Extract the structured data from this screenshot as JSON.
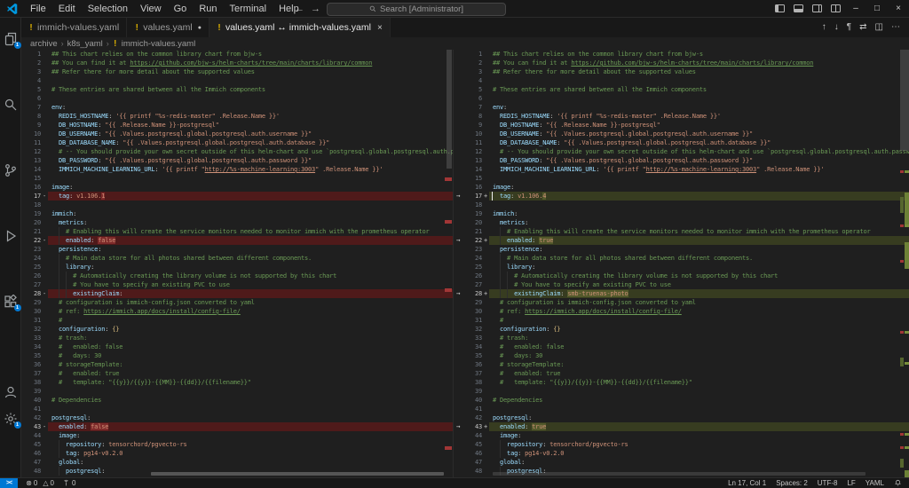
{
  "title_bar": {
    "menus": [
      "File",
      "Edit",
      "Selection",
      "View",
      "Go",
      "Run",
      "Terminal",
      "Help"
    ],
    "nav_back": "←",
    "nav_forward": "→",
    "search_label": "Search [Administrator]"
  },
  "tabs": [
    {
      "label": "immich-values.yaml",
      "icon": "!",
      "modified": false,
      "active": false
    },
    {
      "label": "values.yaml",
      "icon": "!",
      "modified": true,
      "active": false
    },
    {
      "label": "values.yaml ↔ immich-values.yaml",
      "icon": "!",
      "modified": false,
      "active": true,
      "closable": true
    }
  ],
  "editor_actions": [
    {
      "name": "previous-change",
      "glyph": "↑"
    },
    {
      "name": "next-change",
      "glyph": "↓"
    },
    {
      "name": "toggle-whitespace",
      "glyph": "¶"
    },
    {
      "name": "swap-diff-sides",
      "glyph": "⇄"
    },
    {
      "name": "split-editor",
      "glyph": "◫"
    },
    {
      "name": "more-actions",
      "glyph": "⋯"
    }
  ],
  "breadcrumb": [
    "archive",
    "k8s_yaml",
    "immich-values.yaml"
  ],
  "activity_bar": {
    "items": [
      {
        "name": "explorer",
        "badge": "1"
      },
      {
        "name": "search"
      },
      {
        "name": "source-control"
      },
      {
        "name": "run-and-debug"
      },
      {
        "name": "extensions",
        "badge": "1"
      }
    ],
    "bottom": [
      {
        "name": "accounts"
      },
      {
        "name": "settings",
        "badge": "1"
      }
    ]
  },
  "diff": {
    "lines": [
      {
        "n": 1,
        "text": "## This chart relies on the common library chart from bjw-s"
      },
      {
        "n": 2,
        "text": "## You can find it at https://github.com/bjw-s/helm-charts/tree/main/charts/library/common"
      },
      {
        "n": 3,
        "text": "## Refer there for more detail about the supported values"
      },
      {
        "n": 4,
        "text": ""
      },
      {
        "n": 5,
        "text": "# These entries are shared between all the Immich components"
      },
      {
        "n": 6,
        "text": ""
      },
      {
        "n": 7,
        "text": "env:"
      },
      {
        "n": 8,
        "text": "  REDIS_HOSTNAME: '{{ printf \"%s-redis-master\" .Release.Name }}'"
      },
      {
        "n": 9,
        "text": "  DB_HOSTNAME: \"{{ .Release.Name }}-postgresql\""
      },
      {
        "n": 10,
        "text": "  DB_USERNAME: \"{{ .Values.postgresql.global.postgresql.auth.username }}\""
      },
      {
        "n": 11,
        "text": "  DB_DATABASE_NAME: \"{{ .Values.postgresql.global.postgresql.auth.database }}\""
      },
      {
        "n": 12,
        "text": "  # -- You should provide your own secret outside of this helm-chart and use `postgresql.global.postgresql.auth.password`"
      },
      {
        "n": 13,
        "text": "  DB_PASSWORD: \"{{ .Values.postgresql.global.postgresql.auth.password }}\""
      },
      {
        "n": 14,
        "text": "  IMMICH_MACHINE_LEARNING_URL: '{{ printf \"http://%s-machine-learning:3003\" .Release.Name }}'"
      },
      {
        "n": 15,
        "text": ""
      },
      {
        "n": 16,
        "text": "image:"
      },
      {
        "n": 17,
        "change": true,
        "left": "  tag: v1.106.1",
        "right": "  tag: v1.106.4",
        "left_hl": "1",
        "right_hl": "4",
        "cursor": "right"
      },
      {
        "n": 18,
        "text": ""
      },
      {
        "n": 19,
        "text": "immich:"
      },
      {
        "n": 20,
        "text": "  metrics:"
      },
      {
        "n": 21,
        "text": "    # Enabling this will create the service monitors needed to monitor immich with the prometheus operator"
      },
      {
        "n": 22,
        "change": true,
        "left": "    enabled: false",
        "right": "    enabled: true",
        "left_hl": "false",
        "right_hl": "true"
      },
      {
        "n": 23,
        "text": "  persistence:"
      },
      {
        "n": 24,
        "text": "    # Main data store for all photos shared between different components."
      },
      {
        "n": 25,
        "text": "    library:"
      },
      {
        "n": 26,
        "text": "      # Automatically creating the library volume is not supported by this chart"
      },
      {
        "n": 27,
        "text": "      # You have to specify an existing PVC to use"
      },
      {
        "n": 28,
        "change": true,
        "left": "      existingClaim:",
        "right": "      existingClaim: smb-truenas-photo",
        "right_hl": "smb-truenas-photo"
      },
      {
        "n": 29,
        "text": "  # configuration is immich-config.json converted to yaml"
      },
      {
        "n": 30,
        "text": "  # ref: https://immich.app/docs/install/config-file/"
      },
      {
        "n": 31,
        "text": "  #"
      },
      {
        "n": 32,
        "text": "  configuration: {}"
      },
      {
        "n": 33,
        "text": "  # trash:"
      },
      {
        "n": 34,
        "text": "  #   enabled: false"
      },
      {
        "n": 35,
        "text": "  #   days: 30"
      },
      {
        "n": 36,
        "text": "  # storageTemplate:"
      },
      {
        "n": 37,
        "text": "  #   enabled: true"
      },
      {
        "n": 38,
        "text": "  #   template: \"{{y}}/{{y}}-{{MM}}-{{dd}}/{{filename}}\""
      },
      {
        "n": 39,
        "text": ""
      },
      {
        "n": 40,
        "text": "# Dependencies"
      },
      {
        "n": 41,
        "text": ""
      },
      {
        "n": 42,
        "text": "postgresql:"
      },
      {
        "n": 43,
        "change": true,
        "left": "  enabled: false",
        "right": "  enabled: true",
        "left_hl": "false",
        "right_hl": "true"
      },
      {
        "n": 44,
        "text": "  image:"
      },
      {
        "n": 45,
        "text": "    repository: tensorchord/pgvecto-rs"
      },
      {
        "n": 46,
        "text": "    tag: pg14-v0.2.0"
      },
      {
        "n": 47,
        "text": "  global:"
      },
      {
        "n": 48,
        "text": "    postgresql:"
      }
    ]
  },
  "status_bar": {
    "remote_indicator": "><",
    "errors": "0",
    "warnings": "0",
    "ports": "0",
    "line_col": "Ln 17, Col 1",
    "indentation": "Spaces: 2",
    "encoding": "UTF-8",
    "eol": "LF",
    "language": "YAML"
  },
  "colors": {
    "accent_blue": "#0078d4",
    "removed_line_bg": "#4f1a1a",
    "removed_word_bg": "#7e2a2a",
    "added_line_bg": "#373c20",
    "added_word_bg": "#53592b",
    "comment_green": "#6a9955",
    "key_blue": "#9cdcfe",
    "string_orange": "#ce9178",
    "file_icon_yellow": "#ddb100"
  }
}
